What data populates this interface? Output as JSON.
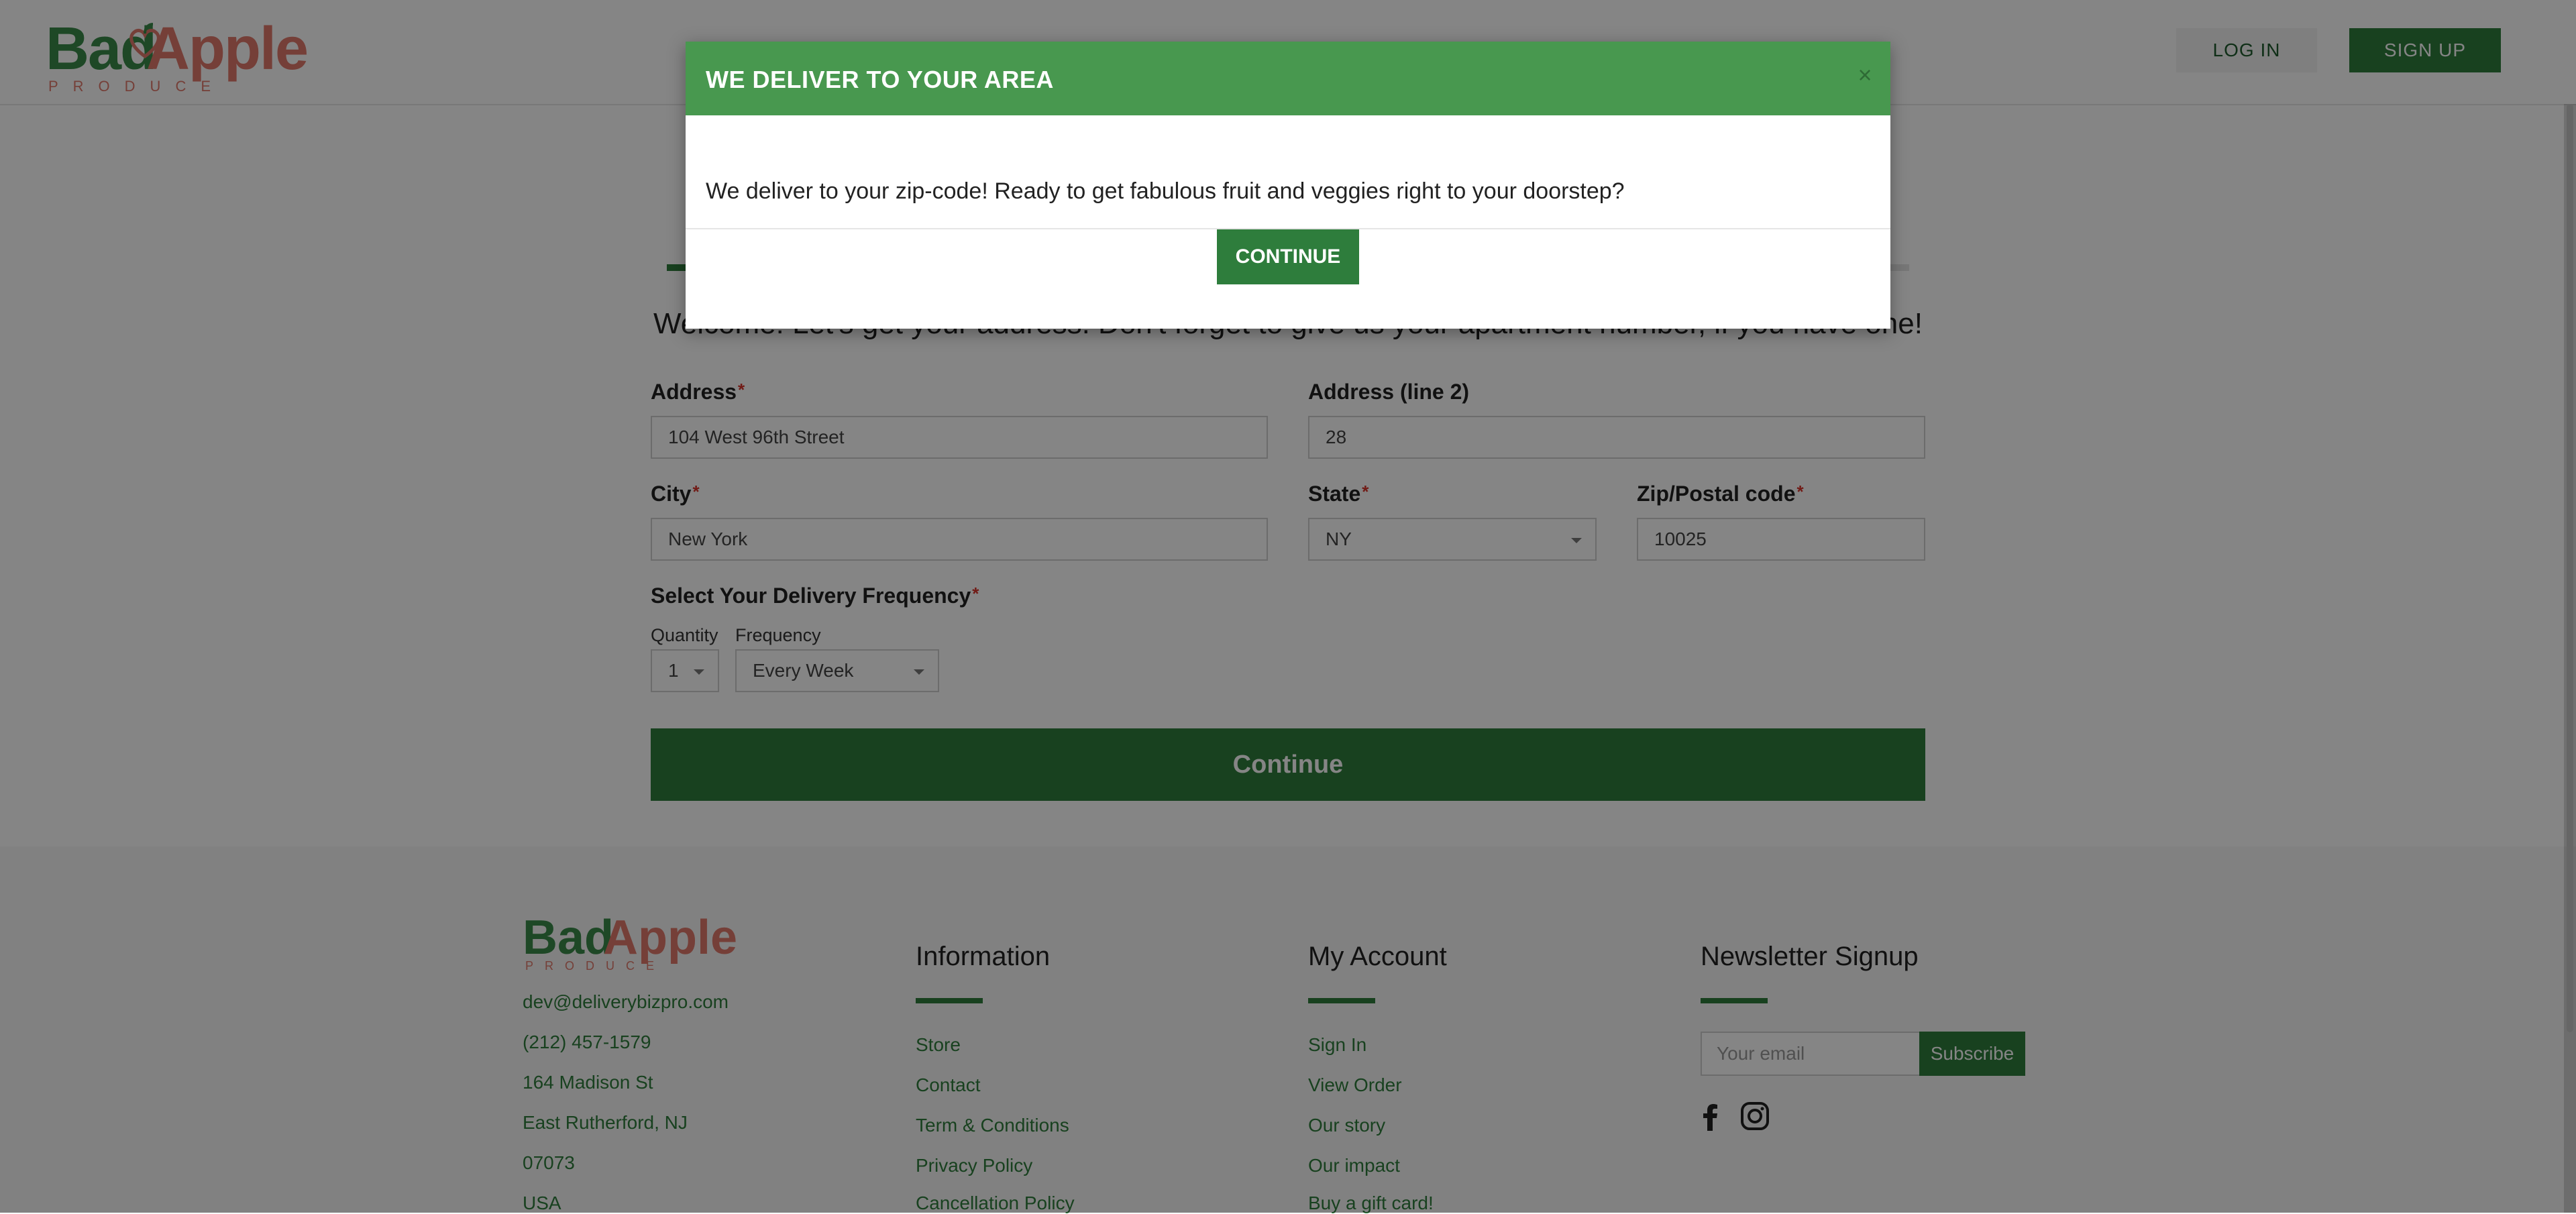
{
  "header": {
    "logo": {
      "word1": "Bad",
      "word2": "Apple",
      "tagline": "PRODUCE"
    },
    "login_label": "LOG IN",
    "signup_label": "SIGN UP"
  },
  "progress": {
    "fraction": 0.02
  },
  "form": {
    "welcome": "Welcome! Let's get your address. Don't forget to give us your apartment number, if you have one!",
    "address": {
      "label": "Address",
      "value": "104 West 96th Street"
    },
    "address2": {
      "label": "Address (line 2)",
      "value": "28"
    },
    "city": {
      "label": "City",
      "value": "New York"
    },
    "state": {
      "label": "State",
      "value": "NY"
    },
    "zip": {
      "label": "Zip/Postal code",
      "value": "10025"
    },
    "frequency": {
      "label": "Select Your Delivery Frequency",
      "quantity_label": "Quantity",
      "quantity_value": "1",
      "frequency_label": "Frequency",
      "frequency_value": "Every Week"
    },
    "required_marker": "*",
    "continue_label": "Continue"
  },
  "footer": {
    "logo": {
      "word1": "Bad",
      "word2": "Apple",
      "tagline": "PRODUCE"
    },
    "contact": [
      "dev@deliverybizpro.com",
      "(212) 457-1579",
      "164 Madison St",
      "East Rutherford, NJ",
      "07073",
      "USA"
    ],
    "information": {
      "title": "Information",
      "links": [
        "Store",
        "Contact",
        "Term & Conditions",
        "Privacy Policy",
        "Cancellation Policy"
      ]
    },
    "account": {
      "title": "My Account",
      "links": [
        "Sign In",
        "View Order",
        "Our story",
        "Our impact",
        "Buy a gift card!"
      ]
    },
    "newsletter": {
      "title": "Newsletter Signup",
      "placeholder": "Your email",
      "subscribe_label": "Subscribe"
    },
    "social_icons": [
      "facebook-icon",
      "instagram-icon"
    ]
  },
  "modal": {
    "title": "WE DELIVER TO YOUR AREA",
    "close_glyph": "×",
    "message": "We deliver to your zip-code! Ready to get fabulous fruit and veggies right to your doorstep?",
    "continue_label": "CONTINUE"
  },
  "colors": {
    "brand_green": "#2e7d3c",
    "modal_header": "#48984f",
    "apple_pink": "#e07a6c",
    "required": "#d9342b"
  }
}
